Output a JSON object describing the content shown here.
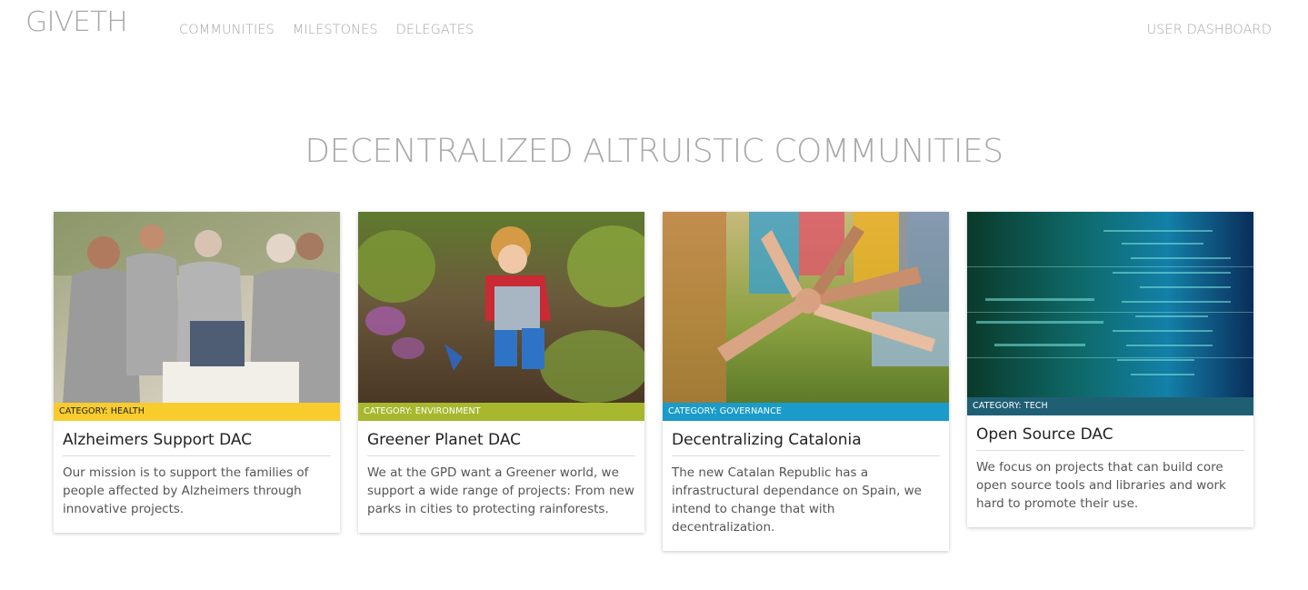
{
  "header": {
    "logo_text": "GIVETH",
    "nav": [
      "COMMUNITIES",
      "MILESTONES",
      "DELEGATES"
    ],
    "user_link": "USER DASHBOARD"
  },
  "main": {
    "title": "DECENTRALIZED ALTRUISTIC COMMUNITIES"
  },
  "cards": [
    {
      "category": "CATEGORY: HEALTH",
      "category_color": "#f9cc2e",
      "title": "Alzheimers Support DAC",
      "description": "Our mission is to support the families of people affected by Alzheimers through innovative projects."
    },
    {
      "category": "CATEGORY: ENVIRONMENT",
      "category_color": "#a7b82f",
      "title": "Greener Planet DAC",
      "description": "We at the GPD want a Greener world, we support a wide range of projects: From new parks in cities to protecting rainforests."
    },
    {
      "category": "CATEGORY: GOVERNANCE",
      "category_color": "#1a9bc9",
      "title": "Decentralizing Catalonia",
      "description": "The new Catalan Republic has a infrastructural dependance on Spain, we intend to change that with decentralization."
    },
    {
      "category": "CATEGORY: TECH",
      "category_color": "#1f5f74",
      "title": "Open Source DAC",
      "description": "We focus on projects that can build core open source tools and libraries and work hard to promote their use."
    }
  ]
}
